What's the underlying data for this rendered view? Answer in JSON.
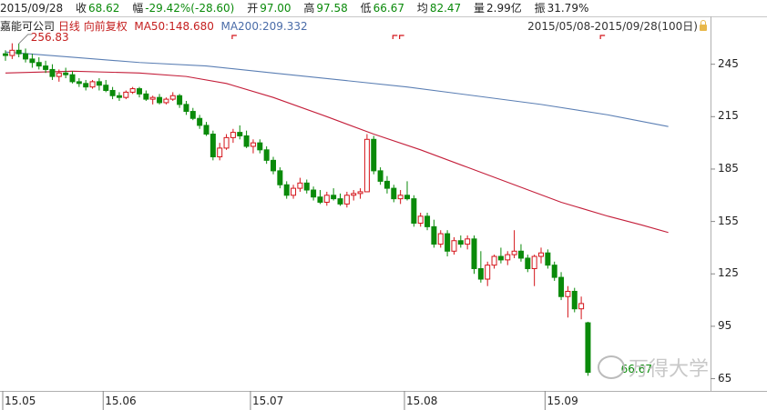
{
  "info": {
    "date": "2015/09/28",
    "close_label": "收",
    "close": "68.62",
    "change_label": "幅",
    "change": "-29.42%(-28.60)",
    "open_label": "开",
    "open": "97.00",
    "high_label": "高",
    "high": "97.58",
    "low_label": "低",
    "low": "66.67",
    "avg_label": "均",
    "avg": "82.47",
    "vol_label": "量",
    "vol": "2.99亿",
    "amp_label": "振",
    "amp": "31.79%"
  },
  "legend": {
    "name": "嘉能可公司",
    "period": "日线",
    "adjust": "向前复权",
    "ma50": "MA50:148.680",
    "ma200": "MA200:209.332"
  },
  "range_text": "2015/05/08-2015/09/28(100日)",
  "watermark": "万得大学",
  "colors": {
    "up": "#d4141a",
    "down": "#0a8a0a",
    "ma50": "#c41e3a",
    "ma200": "#5b7fb4"
  },
  "chart_data": {
    "type": "candlestick",
    "title": "",
    "xlabel": "",
    "ylabel": "",
    "ylim": [
      58,
      262
    ],
    "yticks": [
      245,
      215,
      185,
      155,
      125,
      95,
      65
    ],
    "xticks": [
      {
        "label": "15.05",
        "index": 0
      },
      {
        "label": "15.06",
        "index": 15
      },
      {
        "label": "15.07",
        "index": 37
      },
      {
        "label": "15.08",
        "index": 60
      },
      {
        "label": "15.09",
        "index": 81
      }
    ],
    "annotations": [
      {
        "text": "256.83",
        "index": 2,
        "value": 256.83,
        "kind": "high"
      },
      {
        "text": "66.67",
        "index": 99,
        "value": 66.67,
        "kind": "low"
      }
    ],
    "candles": [
      [
        251,
        253,
        247,
        250
      ],
      [
        250,
        257,
        248,
        253
      ],
      [
        253,
        256.83,
        249,
        251
      ],
      [
        251,
        254,
        246,
        248
      ],
      [
        248,
        251,
        243,
        246
      ],
      [
        246,
        249,
        242,
        244
      ],
      [
        244,
        247,
        240,
        242
      ],
      [
        242,
        245,
        236,
        238
      ],
      [
        238,
        242,
        235,
        240
      ],
      [
        240,
        243,
        237,
        239
      ],
      [
        239,
        241,
        234,
        235
      ],
      [
        235,
        237,
        232,
        234
      ],
      [
        234,
        236,
        230,
        232
      ],
      [
        232,
        236,
        231,
        235
      ],
      [
        235,
        237,
        230,
        233
      ],
      [
        233,
        236,
        229,
        230
      ],
      [
        230,
        232,
        225,
        227
      ],
      [
        227,
        229,
        224,
        226
      ],
      [
        226,
        230,
        225,
        229
      ],
      [
        229,
        232,
        228,
        231
      ],
      [
        231,
        232,
        226,
        228
      ],
      [
        228,
        230,
        224,
        225
      ],
      [
        225,
        227,
        222,
        226
      ],
      [
        226,
        228,
        222,
        223
      ],
      [
        223,
        226,
        222,
        225
      ],
      [
        225,
        229,
        224,
        227
      ],
      [
        227,
        228,
        220,
        222
      ],
      [
        222,
        224,
        216,
        218
      ],
      [
        218,
        220,
        213,
        214
      ],
      [
        214,
        216,
        208,
        210
      ],
      [
        210,
        212,
        204,
        205
      ],
      [
        205,
        207,
        190,
        192
      ],
      [
        192,
        200,
        190,
        197
      ],
      [
        197,
        205,
        196,
        203
      ],
      [
        203,
        208,
        200,
        206
      ],
      [
        206,
        210,
        202,
        204
      ],
      [
        204,
        207,
        197,
        198
      ],
      [
        198,
        202,
        194,
        200
      ],
      [
        200,
        202,
        194,
        196
      ],
      [
        196,
        198,
        188,
        190
      ],
      [
        190,
        192,
        182,
        184
      ],
      [
        184,
        186,
        174,
        176
      ],
      [
        176,
        178,
        168,
        170
      ],
      [
        170,
        176,
        168,
        174
      ],
      [
        174,
        180,
        172,
        177
      ],
      [
        177,
        179,
        171,
        173
      ],
      [
        173,
        175,
        167,
        169
      ],
      [
        169,
        173,
        165,
        166
      ],
      [
        166,
        172,
        164,
        170
      ],
      [
        170,
        174,
        167,
        168
      ],
      [
        168,
        171,
        164,
        165
      ],
      [
        165,
        172,
        163,
        170
      ],
      [
        170,
        173,
        167,
        171
      ],
      [
        171,
        174,
        168,
        172
      ],
      [
        172,
        205,
        172,
        202
      ],
      [
        202,
        204,
        182,
        184
      ],
      [
        184,
        186,
        176,
        178
      ],
      [
        178,
        181,
        171,
        174
      ],
      [
        174,
        176,
        166,
        168
      ],
      [
        168,
        173,
        165,
        170
      ],
      [
        170,
        178,
        167,
        168
      ],
      [
        168,
        170,
        152,
        154
      ],
      [
        154,
        160,
        152,
        158
      ],
      [
        158,
        160,
        150,
        152
      ],
      [
        152,
        156,
        140,
        142
      ],
      [
        142,
        150,
        140,
        148
      ],
      [
        148,
        150,
        135,
        138
      ],
      [
        138,
        146,
        136,
        144
      ],
      [
        144,
        147,
        140,
        142
      ],
      [
        142,
        147,
        139,
        145
      ],
      [
        145,
        147,
        125,
        128
      ],
      [
        128,
        138,
        120,
        122
      ],
      [
        122,
        132,
        118,
        130
      ],
      [
        130,
        136,
        128,
        135
      ],
      [
        135,
        140,
        131,
        133
      ],
      [
        133,
        138,
        130,
        136
      ],
      [
        136,
        150,
        134,
        138
      ],
      [
        138,
        142,
        132,
        134
      ],
      [
        134,
        136,
        126,
        128
      ],
      [
        128,
        136,
        118,
        135
      ],
      [
        135,
        140,
        131,
        137
      ],
      [
        137,
        139,
        128,
        130
      ],
      [
        130,
        132,
        121,
        123
      ],
      [
        123,
        126,
        110,
        112
      ],
      [
        112,
        118,
        100,
        115
      ],
      [
        115,
        117,
        103,
        105
      ],
      [
        105,
        112,
        99,
        108
      ],
      [
        97,
        97.58,
        66.67,
        68.62
      ]
    ],
    "series": [
      {
        "name": "MA50",
        "points": [
          [
            0,
            240
          ],
          [
            10,
            241
          ],
          [
            20,
            240
          ],
          [
            27,
            238
          ],
          [
            33,
            234
          ],
          [
            40,
            226
          ],
          [
            48,
            215
          ],
          [
            55,
            205
          ],
          [
            62,
            196
          ],
          [
            69,
            186
          ],
          [
            76,
            176
          ],
          [
            83,
            166
          ],
          [
            90,
            158
          ],
          [
            95,
            153
          ],
          [
            99,
            148.68
          ]
        ]
      },
      {
        "name": "MA200",
        "points": [
          [
            0,
            252
          ],
          [
            10,
            249
          ],
          [
            20,
            246
          ],
          [
            30,
            244
          ],
          [
            40,
            240
          ],
          [
            50,
            236
          ],
          [
            60,
            232
          ],
          [
            70,
            227
          ],
          [
            80,
            222
          ],
          [
            90,
            216
          ],
          [
            99,
            209.33
          ]
        ]
      }
    ]
  }
}
